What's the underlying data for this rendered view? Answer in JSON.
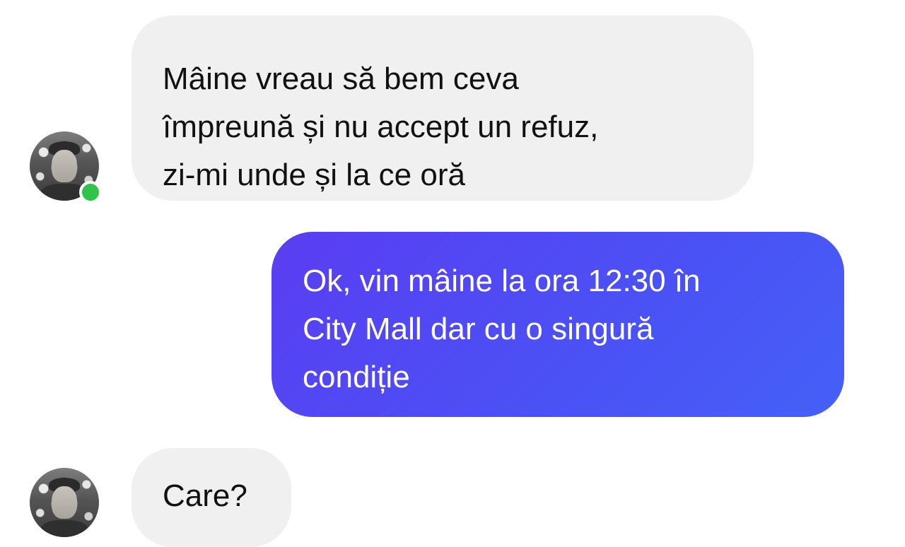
{
  "conversation": {
    "messages": [
      {
        "direction": "incoming",
        "lines": [
          "Mâine vreau să bem ceva",
          "împreună și nu accept un refuz,",
          "zi-mi unde și la ce oră"
        ]
      },
      {
        "direction": "outgoing",
        "lines": [
          "Ok, vin mâine la ora 12:30 în",
          "City Mall dar cu o singură",
          "condiție"
        ]
      },
      {
        "direction": "incoming",
        "lines": [
          "Care?"
        ]
      }
    ],
    "contact": {
      "status": "online"
    }
  },
  "colors": {
    "incoming_bubble": "#f0f0f0",
    "outgoing_bubble": "#4a52f5",
    "online_indicator": "#31c24a"
  }
}
